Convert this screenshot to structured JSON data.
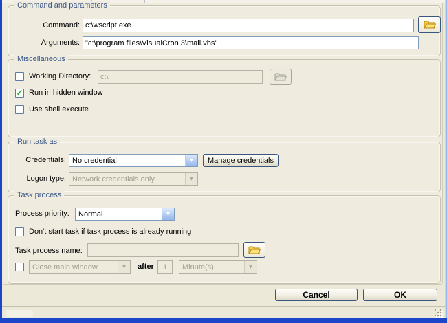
{
  "icons": {
    "chevron": "▾",
    "check": "✓"
  },
  "command_group": {
    "title": "Command and parameters",
    "command_label": "Command:",
    "command_value": "c:\\wscript.exe",
    "arguments_label": "Arguments:",
    "arguments_value": "\"c:\\program files\\VisualCron 3\\mail.vbs\""
  },
  "misc_group": {
    "title": "Miscellaneous",
    "working_directory_label": "Working Directory:",
    "working_directory_value": "c:\\",
    "run_hidden_label": "Run in hidden window",
    "use_shell_label": "Use shell execute"
  },
  "run_task_group": {
    "title": "Run task as",
    "credentials_label": "Credentials:",
    "credentials_value": "No credential",
    "manage_credentials_label": "Manage credentials",
    "logon_type_label": "Logon type:",
    "logon_type_value": "Network credentials only"
  },
  "task_process_group": {
    "title": "Task process",
    "priority_label": "Process priority:",
    "priority_value": "Normal",
    "dont_start_label": "Don't start task if task process is already running",
    "process_name_label": "Task process name:",
    "process_name_value": "",
    "close_window_value": "Close main window",
    "after_label": "after",
    "after_value": "1",
    "unit_value": "Minute(s)"
  },
  "footer": {
    "cancel_label": "Cancel",
    "ok_label": "OK"
  },
  "states": {
    "working_directory_checked": false,
    "run_hidden_checked": true,
    "use_shell_checked": false,
    "dont_start_checked": false,
    "close_window_checked": false
  },
  "colors": {
    "window_border": "#1b46c9",
    "dialog_bg": "#ece9d8",
    "panel_bg": "#efecdf",
    "group_caption": "#3a5787",
    "field_border": "#7f9db9",
    "combo_button_blue": "#94b6ec",
    "check_green": "#23a423",
    "folder_yellow": "#f7d24a"
  }
}
